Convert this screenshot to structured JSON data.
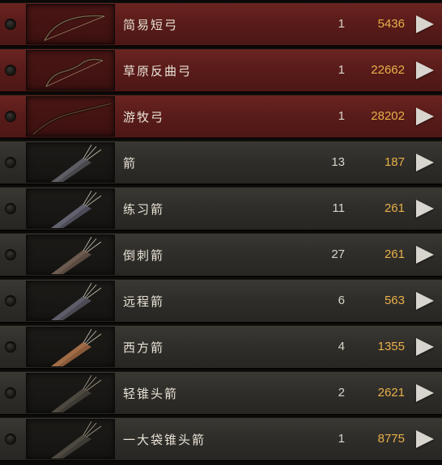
{
  "items": [
    {
      "name": "简易短弓",
      "qty": "1",
      "price": "5436",
      "kind": "bow",
      "icon": "short-bow-icon"
    },
    {
      "name": "草原反曲弓",
      "qty": "1",
      "price": "22662",
      "kind": "bow",
      "icon": "recurve-bow-icon"
    },
    {
      "name": "游牧弓",
      "qty": "1",
      "price": "28202",
      "kind": "bow",
      "icon": "nomad-bow-icon"
    },
    {
      "name": "箭",
      "qty": "13",
      "price": "187",
      "kind": "arrow",
      "icon": "quiver-icon"
    },
    {
      "name": "练习箭",
      "qty": "11",
      "price": "261",
      "kind": "arrow",
      "icon": "quiver-icon"
    },
    {
      "name": "倒刺箭",
      "qty": "27",
      "price": "261",
      "kind": "arrow",
      "icon": "quiver-icon"
    },
    {
      "name": "远程箭",
      "qty": "6",
      "price": "563",
      "kind": "arrow",
      "icon": "quiver-icon"
    },
    {
      "name": "西方箭",
      "qty": "4",
      "price": "1355",
      "kind": "arrow",
      "icon": "quiver-icon"
    },
    {
      "name": "轻锥头箭",
      "qty": "2",
      "price": "2621",
      "kind": "arrow",
      "icon": "quiver-icon"
    },
    {
      "name": "一大袋锥头箭",
      "qty": "1",
      "price": "8775",
      "kind": "arrow",
      "icon": "quiver-icon"
    }
  ],
  "colors": {
    "bow_row": "#5a1c1a",
    "arrow_row": "#2f2d29",
    "price_text": "#e8b04a",
    "name_text": "#e8e2d6"
  }
}
